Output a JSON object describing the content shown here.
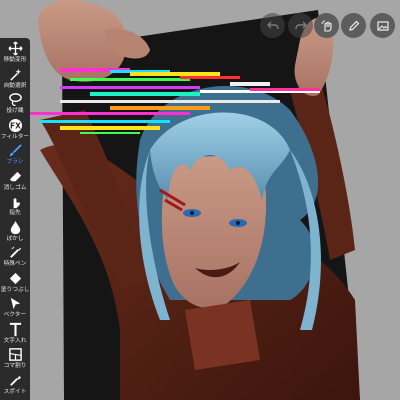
{
  "tools": [
    {
      "id": "transform",
      "label": "移動変形",
      "icon": "move-arrows-icon"
    },
    {
      "id": "auto-select",
      "label": "自動選択",
      "icon": "magic-wand-icon"
    },
    {
      "id": "lasso",
      "label": "投げ縄",
      "icon": "lasso-icon"
    },
    {
      "id": "filter",
      "label": "フィルター",
      "icon": "fx-icon"
    },
    {
      "id": "brush",
      "label": "ブラシ",
      "icon": "brush-icon",
      "active": true
    },
    {
      "id": "eraser",
      "label": "消しゴム",
      "icon": "eraser-icon"
    },
    {
      "id": "smudge",
      "label": "指先",
      "icon": "finger-icon"
    },
    {
      "id": "blur",
      "label": "ぼかし",
      "icon": "drop-icon"
    },
    {
      "id": "special-pen",
      "label": "特殊ペン",
      "icon": "special-pen-icon"
    },
    {
      "id": "fill",
      "label": "塗りつぶし",
      "icon": "bucket-icon"
    },
    {
      "id": "vector",
      "label": "ベクター",
      "icon": "vector-cursor-icon"
    },
    {
      "id": "text",
      "label": "文字入れ",
      "icon": "text-t-icon"
    },
    {
      "id": "frame-divider",
      "label": "コマ割り",
      "icon": "panel-icon"
    },
    {
      "id": "eyedropper",
      "label": "スポイト",
      "icon": "eyedropper-icon"
    }
  ],
  "topbar": {
    "buttons": [
      {
        "id": "touch-gesture",
        "icon": "touch-hand-icon"
      },
      {
        "id": "edit",
        "icon": "pencil-icon"
      },
      {
        "id": "gallery",
        "icon": "image-icon"
      }
    ],
    "hidden_buttons": [
      {
        "id": "undo",
        "icon": "undo-icon"
      },
      {
        "id": "redo",
        "icon": "redo-icon"
      }
    ]
  },
  "colors": {
    "background": "#a6a6a6",
    "toolbar": "#2b2b2b",
    "accent": "#4a9fff",
    "label": "#e8e8e8"
  }
}
